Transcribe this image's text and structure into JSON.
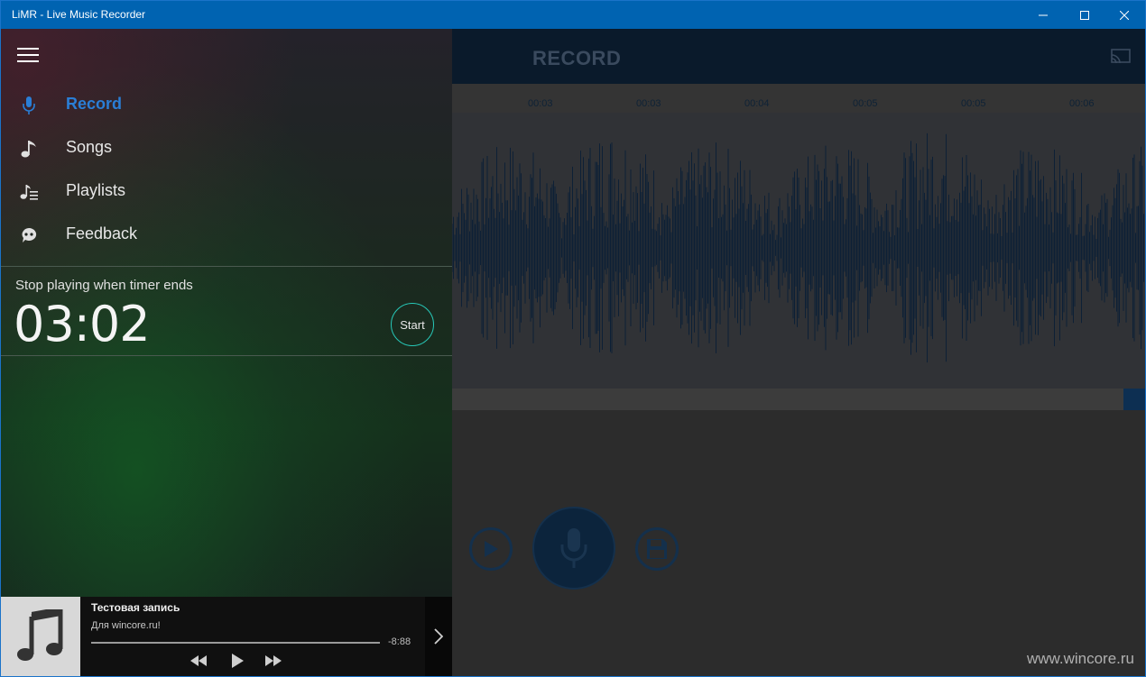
{
  "window": {
    "title": "LiMR - Live Music Recorder"
  },
  "header": {
    "title": "RECORD"
  },
  "ruler": {
    "ticks": [
      "00:03",
      "00:03",
      "00:04",
      "00:05",
      "00:05",
      "00:06"
    ]
  },
  "nav": {
    "items": [
      {
        "label": "Record",
        "icon": "microphone-icon",
        "active": true
      },
      {
        "label": "Songs",
        "icon": "music-note-icon"
      },
      {
        "label": "Playlists",
        "icon": "playlist-icon"
      },
      {
        "label": "Feedback",
        "icon": "feedback-icon"
      }
    ]
  },
  "timer": {
    "label": "Stop playing when timer ends",
    "value": "03:02",
    "start_label": "Start"
  },
  "now_playing": {
    "title": "Тестовая запись",
    "subtitle": "Для wincore.ru!",
    "remaining": "-8:88"
  },
  "watermark": "www.wincore.ru",
  "colors": {
    "accent": "#0063b1",
    "active_nav": "#2a7ed6",
    "timer_ring": "#27c8b8",
    "waveform": "#0d2036"
  }
}
